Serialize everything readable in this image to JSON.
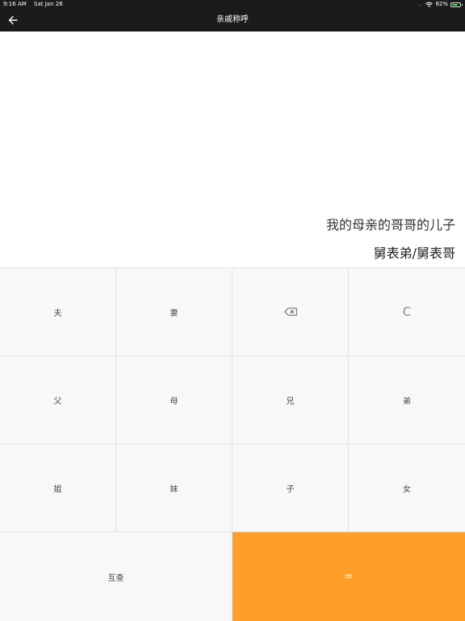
{
  "status_bar": {
    "time": "9:16 AM",
    "date": "Sat Jan 26",
    "signal": "....",
    "battery_percent": "82%",
    "battery_level": 0.82,
    "battery_color": "#4cd964"
  },
  "nav": {
    "title": "亲戚称呼",
    "back_icon": "arrow-left-icon"
  },
  "display": {
    "expression": "我的母亲的哥哥的儿子",
    "result": "舅表弟/舅表哥"
  },
  "keypad": {
    "husband": "夫",
    "wife": "妻",
    "backspace_icon": "backspace-icon",
    "clear": "C",
    "father": "父",
    "mother": "母",
    "elder_brother": "兄",
    "younger_brother": "弟",
    "elder_sister": "姐",
    "younger_sister": "妹",
    "son": "子",
    "daughter": "女",
    "mutual_check": "互查",
    "equals": "="
  },
  "colors": {
    "accent": "#ff9f29",
    "bar_background": "#1b1b1b",
    "key_background": "#f8f8f8"
  }
}
